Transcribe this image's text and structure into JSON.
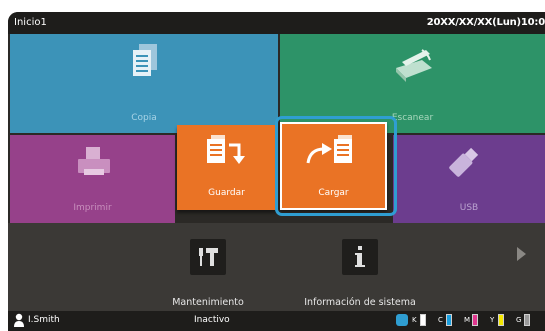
{
  "header": {
    "title": "Inicio1",
    "datetime": "20XX/XX/XX(Lun)10:0"
  },
  "tiles": {
    "copy": {
      "label": "Copia",
      "color": "#3c93b8",
      "icon": "document-icon"
    },
    "scan": {
      "label": "Escanear",
      "color": "#2d9368",
      "icon": "scanner-icon"
    },
    "print": {
      "label": "Imprimir",
      "color": "#96418a",
      "icon": "printer-icon"
    },
    "save": {
      "label": "Guardar",
      "color": "#ea7325",
      "icon": "save-document-icon"
    },
    "load": {
      "label": "Cargar",
      "color": "#ea7325",
      "icon": "load-document-icon"
    },
    "usb": {
      "label": "USB",
      "color": "#6c3d8e",
      "icon": "usb-icon"
    }
  },
  "utilities": {
    "maintenance": {
      "label": "Mantenimiento",
      "icon": "tools-icon"
    },
    "system_info": {
      "label": "Información de sistema",
      "icon": "info-icon"
    }
  },
  "status": {
    "user": "I.Smith",
    "state": "Inactivo",
    "ink": [
      {
        "label": "K",
        "color": "#111111"
      },
      {
        "label": "C",
        "color": "#1aa0e0"
      },
      {
        "label": "M",
        "color": "#e0388f"
      },
      {
        "label": "Y",
        "color": "#f3e600"
      },
      {
        "label": "G",
        "color": "#9a9a9a"
      }
    ]
  },
  "accent_color": "#2f9ed2"
}
